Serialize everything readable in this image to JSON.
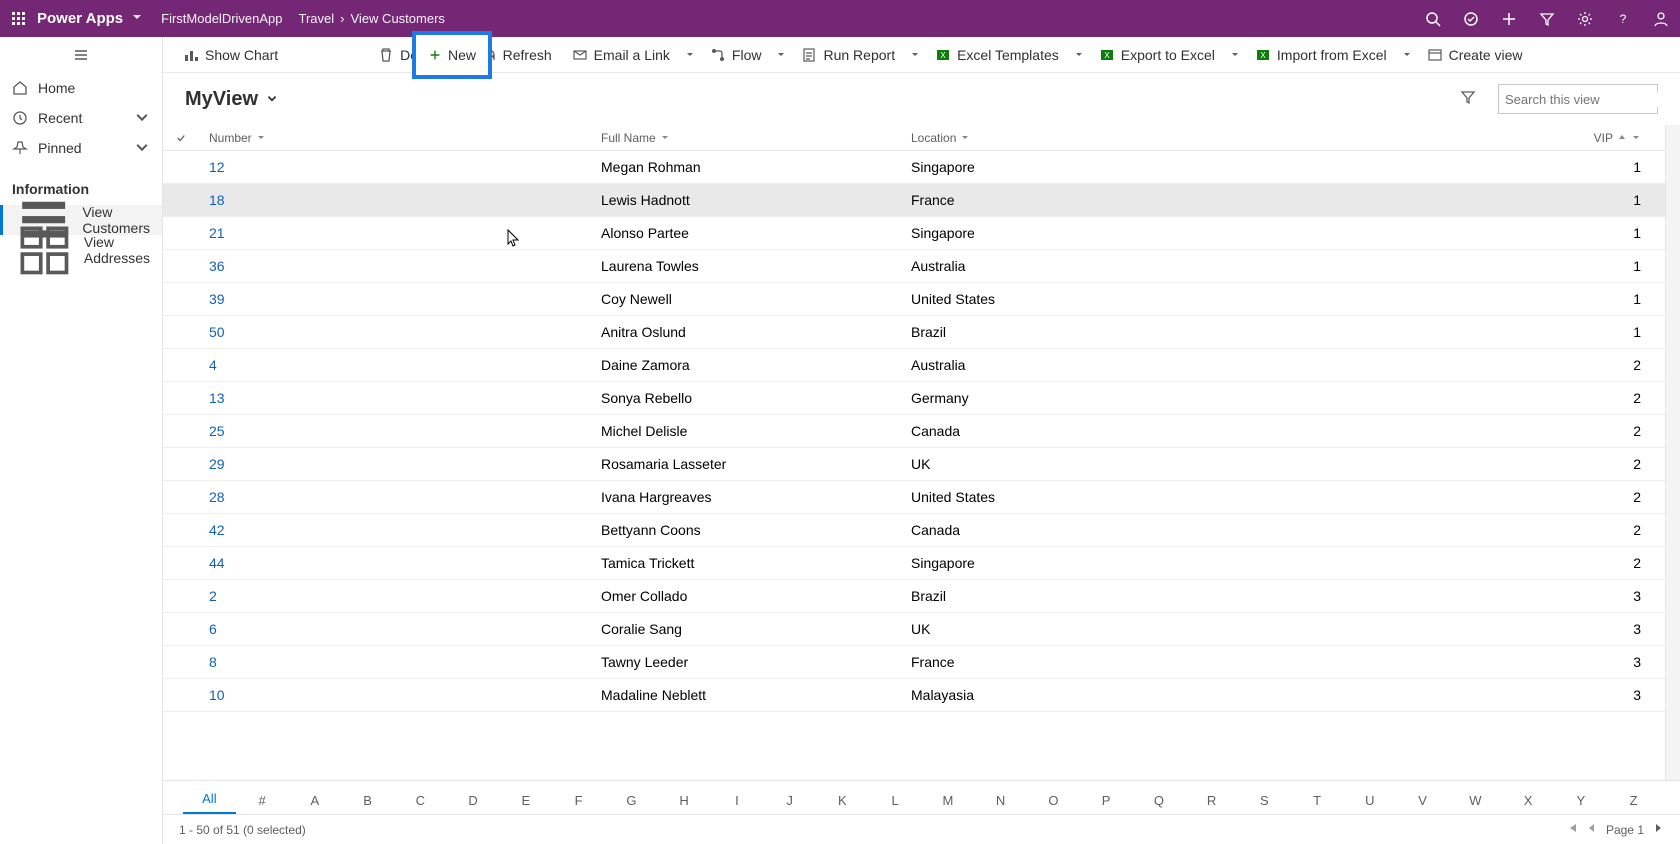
{
  "header": {
    "brand": "Power Apps",
    "app_name": "FirstModelDrivenApp",
    "crumb_area": "Travel",
    "crumb_page": "View Customers"
  },
  "sidebar": {
    "nav_home": "Home",
    "nav_recent": "Recent",
    "nav_pinned": "Pinned",
    "section_title": "Information",
    "area_customers": "View Customers",
    "area_addresses": "View Addresses"
  },
  "cmdbar": {
    "show_chart": "Show Chart",
    "new": "New",
    "delete": "Delete",
    "refresh": "Refresh",
    "email_link": "Email a Link",
    "flow": "Flow",
    "run_report": "Run Report",
    "excel_templates": "Excel Templates",
    "export_excel": "Export to Excel",
    "import_excel": "Import from Excel",
    "create_view": "Create view"
  },
  "view": {
    "name": "MyView",
    "search_placeholder": "Search this view"
  },
  "columns": {
    "number": "Number",
    "full_name": "Full Name",
    "location": "Location",
    "vip": "VIP"
  },
  "rows": [
    {
      "number": "12",
      "name": "Megan Rohman",
      "location": "Singapore",
      "vip": "1"
    },
    {
      "number": "18",
      "name": "Lewis Hadnott",
      "location": "France",
      "vip": "1"
    },
    {
      "number": "21",
      "name": "Alonso Partee",
      "location": "Singapore",
      "vip": "1"
    },
    {
      "number": "36",
      "name": "Laurena Towles",
      "location": "Australia",
      "vip": "1"
    },
    {
      "number": "39",
      "name": "Coy Newell",
      "location": "United States",
      "vip": "1"
    },
    {
      "number": "50",
      "name": "Anitra Oslund",
      "location": "Brazil",
      "vip": "1"
    },
    {
      "number": "4",
      "name": "Daine Zamora",
      "location": "Australia",
      "vip": "2"
    },
    {
      "number": "13",
      "name": "Sonya Rebello",
      "location": "Germany",
      "vip": "2"
    },
    {
      "number": "25",
      "name": "Michel Delisle",
      "location": "Canada",
      "vip": "2"
    },
    {
      "number": "29",
      "name": "Rosamaria Lasseter",
      "location": "UK",
      "vip": "2"
    },
    {
      "number": "28",
      "name": "Ivana Hargreaves",
      "location": "United States",
      "vip": "2"
    },
    {
      "number": "42",
      "name": "Bettyann Coons",
      "location": "Canada",
      "vip": "2"
    },
    {
      "number": "44",
      "name": "Tamica Trickett",
      "location": "Singapore",
      "vip": "2"
    },
    {
      "number": "2",
      "name": "Omer Collado",
      "location": "Brazil",
      "vip": "3"
    },
    {
      "number": "6",
      "name": "Coralie Sang",
      "location": "UK",
      "vip": "3"
    },
    {
      "number": "8",
      "name": "Tawny Leeder",
      "location": "France",
      "vip": "3"
    },
    {
      "number": "10",
      "name": "Madaline Neblett",
      "location": "Malayasia",
      "vip": "3"
    }
  ],
  "alphabar": [
    "All",
    "#",
    "A",
    "B",
    "C",
    "D",
    "E",
    "F",
    "G",
    "H",
    "I",
    "J",
    "K",
    "L",
    "M",
    "N",
    "O",
    "P",
    "Q",
    "R",
    "S",
    "T",
    "U",
    "V",
    "W",
    "X",
    "Y",
    "Z"
  ],
  "status": {
    "range": "1 - 50 of 51 (0 selected)",
    "page_label": "Page 1"
  }
}
